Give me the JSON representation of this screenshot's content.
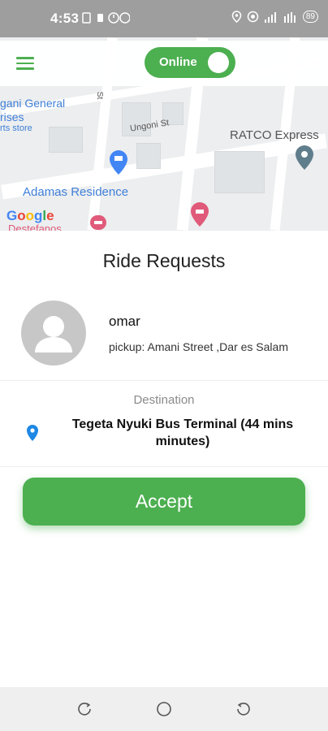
{
  "status_bar": {
    "time": "4:53",
    "battery": "89",
    "left_icons": [
      "sim-icon",
      "notification-icon",
      "timer-icon",
      "vpn-icon"
    ],
    "right_icons": [
      "location-icon",
      "hotspot-icon",
      "signal-icon",
      "network-icon",
      "battery-icon"
    ]
  },
  "header": {
    "toggle_label": "Online",
    "toggle_on": true,
    "menu_icon": "hamburger-icon"
  },
  "map": {
    "labels": {
      "place1_line1": "gani General",
      "place1_line2": "rises",
      "place1_line3": "rts store",
      "street1": "Ungoni St",
      "street2": "St",
      "place2": "RATCO Express",
      "place3": "Adamas Residence",
      "place4": "Destefanos",
      "google": "Google"
    }
  },
  "request": {
    "title": "Ride Requests",
    "rider_name": "omar",
    "pickup": "pickup: Amani Street ,Dar es Salam",
    "destination_label": "Destination",
    "destination_line1": "Tegeta Nyuki Bus Terminal  (44 mins",
    "destination_line2": "minutes)",
    "accept_label": "Accept"
  },
  "colors": {
    "accent": "#4caf50",
    "status_bar": "#9e9e9e",
    "pin": "#1e88e5"
  },
  "nav_bar": {
    "buttons": [
      "recents-icon",
      "home-icon",
      "back-icon"
    ]
  }
}
